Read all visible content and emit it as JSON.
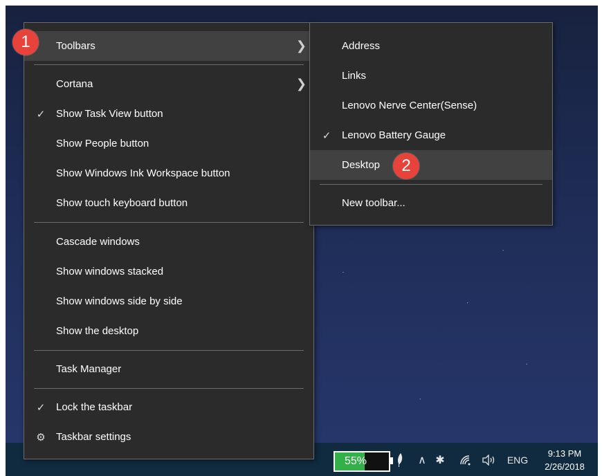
{
  "main_menu": {
    "toolbars": "Toolbars",
    "cortana": "Cortana",
    "show_task_view": "Show Task View button",
    "show_people": "Show People button",
    "show_ink_workspace": "Show Windows Ink Workspace button",
    "show_touch_keyboard": "Show touch keyboard button",
    "cascade": "Cascade windows",
    "stacked": "Show windows stacked",
    "side_by_side": "Show windows side by side",
    "show_desktop": "Show the desktop",
    "task_manager": "Task Manager",
    "lock_taskbar": "Lock the taskbar",
    "taskbar_settings": "Taskbar settings"
  },
  "toolbars_submenu": {
    "address": "Address",
    "links": "Links",
    "lenovo_nerve": "Lenovo Nerve Center(Sense)",
    "lenovo_battery": "Lenovo Battery Gauge",
    "desktop": "Desktop",
    "new_toolbar": "New toolbar..."
  },
  "step_badges": {
    "one": "1",
    "two": "2"
  },
  "icons": {
    "check": "check-icon",
    "chevron": "chevron-right-icon",
    "gear": "gear-icon",
    "sub_check": "check-icon"
  },
  "taskbar": {
    "battery_percent": "55%",
    "battery_level": 0.55,
    "language": "ENG",
    "time": "9:13 PM",
    "date": "2/26/2018"
  },
  "colors": {
    "menu_bg": "#2b2b2b",
    "highlight": "#414141",
    "badge": "#e8433a",
    "taskbar": "#102b3f",
    "battery_fill": "#33b04a"
  }
}
